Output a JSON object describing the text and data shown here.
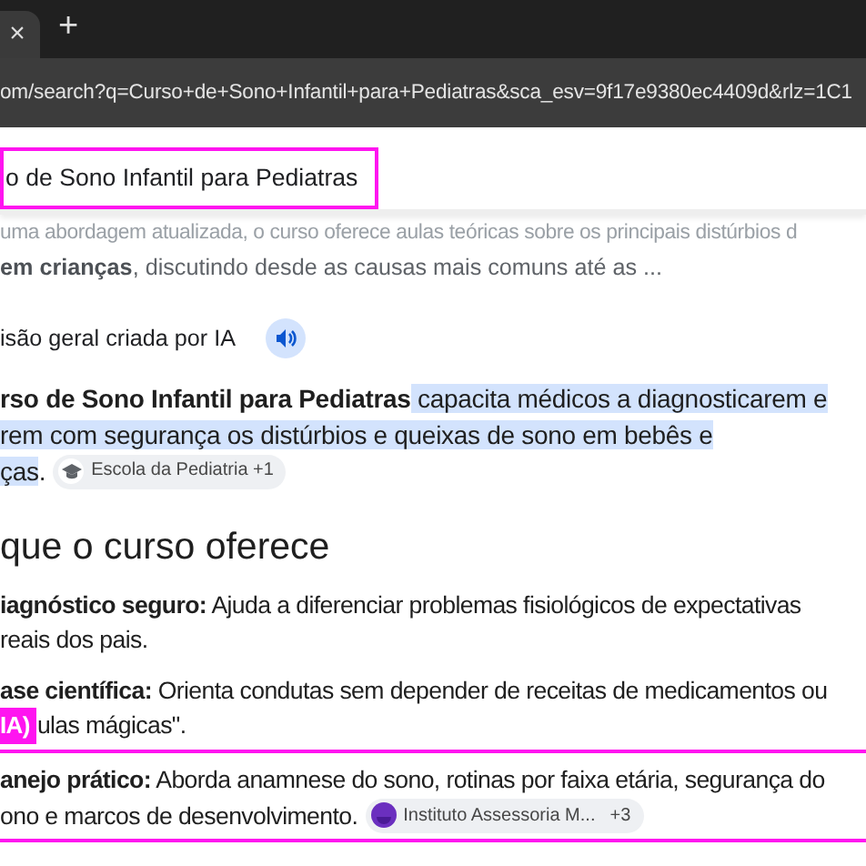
{
  "browser": {
    "tab_close": "×",
    "new_tab": "+",
    "url": "om/search?q=Curso+de+Sono+Infantil+para+Pediatras&sca_esv=9f17e9380ec4409d&rlz=1C1"
  },
  "search": {
    "value": "o de Sono Infantil para Pediatras",
    "outlined": true
  },
  "snippet": [
    "uma abordagem atualizada, o curso oferece aulas teóricas sobre os principais distúrbios d",
    "**em crianças**, discutindo desde as causas mais comuns até as ..."
  ],
  "ai_overview": {
    "label": "isão geral criada por IA",
    "summary": [
      [
        {
          "text": "rso de Sono Infantil para Pediatras",
          "bold": true,
          "highlighted": false
        },
        {
          "text": "capacita médicos a diagnosticarem e",
          "bold": false,
          "highlighted": true
        }
      ],
      [
        {
          "text": "rem com segurança os distúrbios e queixas de sono em bebês e",
          "bold": false,
          "highlighted": true
        }
      ],
      [
        {
          "text": "ças",
          "bold": false,
          "highlighted": true
        },
        {
          "text": ".",
          "bold": false,
          "highlighted": false
        }
      ]
    ],
    "source": {
      "name": "Escola da Pediatria +1"
    }
  },
  "section": {
    "heading": "que o curso oferece",
    "items": [
      {
        "lines": [
          "**iagnóstico seguro:** Ajuda a diferenciar problemas fisiológicos de expectativas",
          "reais dos pais."
        ],
        "outlined": false
      },
      {
        "lines": [
          "**ase científica:** Orienta condutas sem depender de receitas de medicamentos ou",
          "ulas mágicas\"."
        ],
        "tag": "IA)",
        "outlined": false
      },
      {
        "lines": [
          "**anejo prático:** Aborda anamnese do sono, rotinas por faixa etária, segurança do",
          "ono e marcos de desenvolvimento."
        ],
        "outlined": true,
        "source": {
          "name": "Instituto Assessoria M...",
          "more": "+3"
        }
      }
    ]
  }
}
